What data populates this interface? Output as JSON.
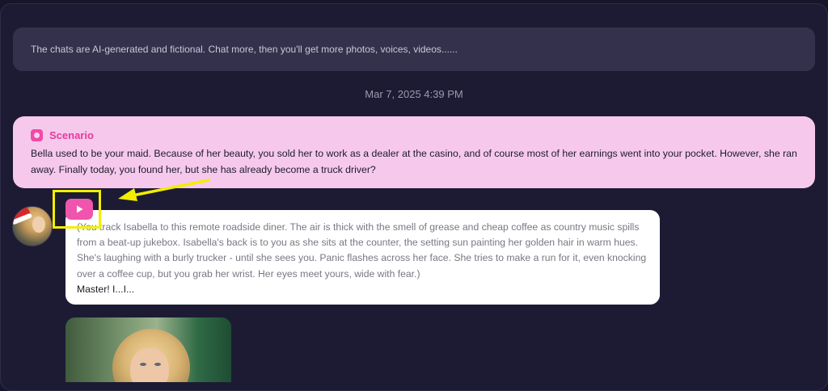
{
  "notice": {
    "text": "The chats are AI-generated and fictional. Chat more, then you'll get more photos, voices, videos......"
  },
  "timestamp": "Mar 7, 2025 4:39 PM",
  "scenario": {
    "title": "Scenario",
    "text": "Bella used to be your maid. Because of her beauty, you sold her to work as a dealer at the casino, and of course most of her earnings went into your pocket. However, she ran away. Finally today, you found her, but she has already become a truck driver?"
  },
  "message": {
    "narration": "(You track Isabella to this remote roadside diner. The air is thick with the smell of grease and cheap coffee as country music spills from a beat-up jukebox. Isabella's back is to you as she sits at the counter, the setting sun painting her golden hair in warm hues. She's laughing with a burly trucker - until she sees you. Panic flashes across her face. She tries to make a run for it, even knocking over a coffee cup, but you grab her wrist. Her eyes meet yours, wide with fear.)",
    "speech": "Master! I...I..."
  },
  "icons": {
    "scenario": "scenario-icon",
    "play": "play-icon",
    "avatar": "avatar"
  },
  "colors": {
    "background": "#1d1b34",
    "notice_bg": "#34314d",
    "scenario_bg": "#f6c9ec",
    "scenario_title": "#e6389e",
    "play_button": "#f055ad",
    "highlight": "#f2ee00"
  }
}
